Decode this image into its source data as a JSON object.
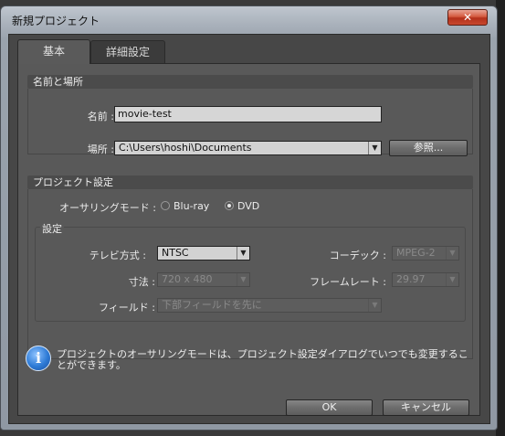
{
  "window": {
    "title": "新規プロジェクト",
    "close_label": "✕"
  },
  "tabs": [
    {
      "label": "基本",
      "selected": true
    },
    {
      "label": "詳細設定",
      "selected": false
    }
  ],
  "name_location": {
    "header": "名前と場所",
    "name_label": "名前 :",
    "name_value": "movie-test",
    "location_label": "場所 :",
    "location_value": "C:\\Users\\hoshi\\Documents",
    "browse_label": "参照..."
  },
  "project_settings": {
    "header": "プロジェクト設定",
    "authoring_mode_label": "オーサリングモード :",
    "modes": [
      {
        "label": "Blu-ray",
        "checked": false
      },
      {
        "label": "DVD",
        "checked": true
      }
    ],
    "settings_group_label": "設定",
    "tv_system_label": "テレビ方式 :",
    "tv_system_value": "NTSC",
    "dimensions_label": "寸法 :",
    "dimensions_value": "720 x 480",
    "field_label": "フィールド :",
    "field_value": "下部フィールドを先に",
    "codec_label": "コーデック :",
    "codec_value": "MPEG-2",
    "framerate_label": "フレームレート :",
    "framerate_value": "29.97"
  },
  "info": {
    "icon": "info-icon",
    "text": "プロジェクトのオーサリングモードは、プロジェクト設定ダイアログでいつでも変更することができます。"
  },
  "buttons": {
    "ok_label": "OK",
    "cancel_label": "キャンセル"
  }
}
